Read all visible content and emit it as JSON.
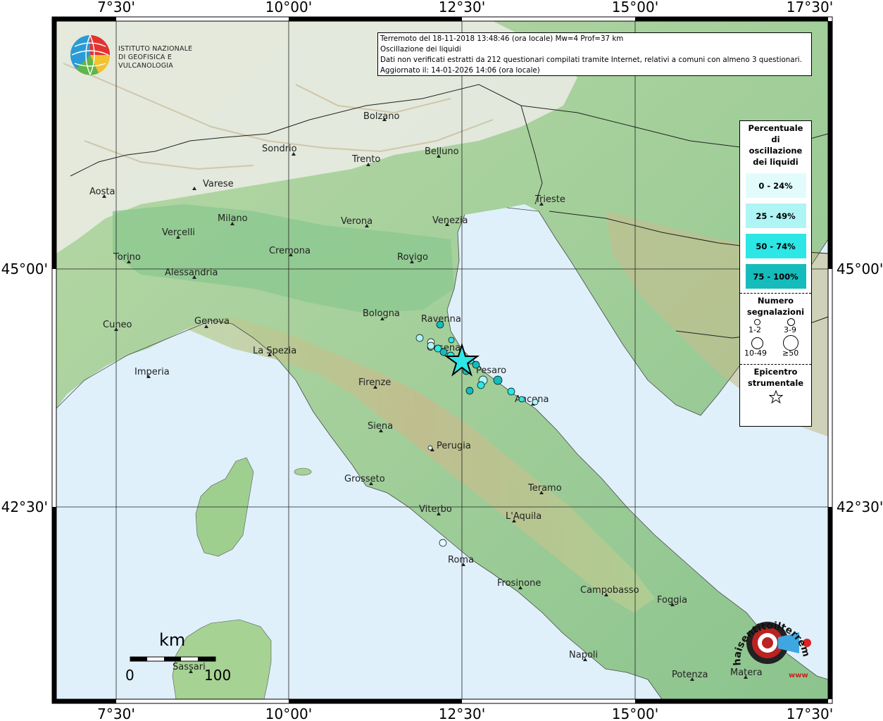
{
  "info": {
    "line1": "Terremoto del 18-11-2018 13:48:46 (ora locale) Mw=4 Prof=37 km",
    "line2": "Oscillazione dei liquidi",
    "line3": "Dati non verificati estratti da 212 questionari compilati tramite Internet, relativi a comuni con almeno 3 questionari.",
    "line4": "Aggiornato il: 14-01-2026 14:06 (ora locale)"
  },
  "logo": {
    "line1": "ISTITUTO NAZIONALE",
    "line2": "DI GEOFISICA E VULCANOLOGIA"
  },
  "axes": {
    "lon_labels": [
      "7°30'",
      "10°00'",
      "12°30'",
      "15°00'",
      "17°30'"
    ],
    "lat_labels": [
      "45°00'",
      "42°30'"
    ]
  },
  "legend": {
    "title": "Percentuale di oscillazione dei liquidi",
    "classes": [
      {
        "label": "0 - 24%",
        "color": "#e2fcfc"
      },
      {
        "label": "25 - 49%",
        "color": "#aff5f5"
      },
      {
        "label": "50 - 74%",
        "color": "#2de6e6"
      },
      {
        "label": "75 - 100%",
        "color": "#16bcbc"
      }
    ],
    "count_title": "Numero segnalazioni",
    "sizes": [
      "1-2",
      "3-9",
      "10-49",
      "≥50"
    ],
    "epicenter_title": "Epicentro strumentale"
  },
  "scale": {
    "unit": "km",
    "min": "0",
    "max": "100"
  },
  "cities": [
    {
      "name": "Bolzano"
    },
    {
      "name": "Sondrio"
    },
    {
      "name": "Belluno"
    },
    {
      "name": "Trento"
    },
    {
      "name": "Aosta"
    },
    {
      "name": "Varese"
    },
    {
      "name": "Trieste"
    },
    {
      "name": "Milano"
    },
    {
      "name": "Verona"
    },
    {
      "name": "Venezia"
    },
    {
      "name": "Vercelli"
    },
    {
      "name": "Cremona"
    },
    {
      "name": "Rovigo"
    },
    {
      "name": "Torino"
    },
    {
      "name": "Alessandria"
    },
    {
      "name": "Bologna"
    },
    {
      "name": "Ravenna"
    },
    {
      "name": "Cuneo"
    },
    {
      "name": "Genova"
    },
    {
      "name": "Cesena"
    },
    {
      "name": "La Spezia"
    },
    {
      "name": "Pesaro"
    },
    {
      "name": "Imperia"
    },
    {
      "name": "Firenze"
    },
    {
      "name": "Ancona"
    },
    {
      "name": "Siena"
    },
    {
      "name": "Perugia"
    },
    {
      "name": "Grosseto"
    },
    {
      "name": "Teramo"
    },
    {
      "name": "Viterbo"
    },
    {
      "name": "L'Aquila"
    },
    {
      "name": "Roma"
    },
    {
      "name": "Frosinone"
    },
    {
      "name": "Campobasso"
    },
    {
      "name": "Foggia"
    },
    {
      "name": "Sassari"
    },
    {
      "name": "Napoli"
    },
    {
      "name": "Potenza"
    },
    {
      "name": "Matera"
    }
  ],
  "badge": {
    "text": "haisentitoilterremoto.it",
    "sub": "www"
  },
  "colors": {
    "sea": "#dff0fb",
    "land": "#a9d39a",
    "plain": "#8fc790",
    "mountain": "#c9b98c",
    "alps": "#eeeeee",
    "border": "#000000"
  }
}
